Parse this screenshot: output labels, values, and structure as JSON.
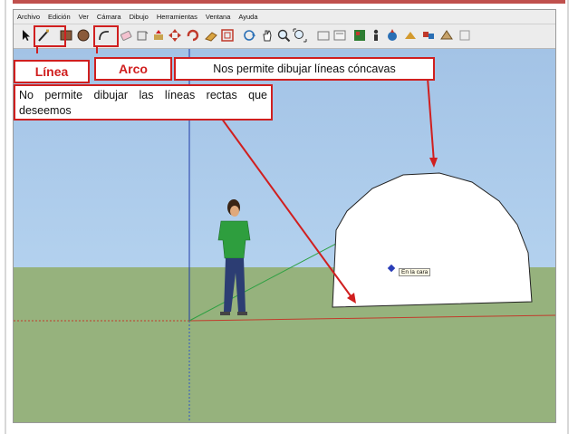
{
  "menu": {
    "items": [
      "Archivo",
      "Edición",
      "Ver",
      "Cámara",
      "Dibujo",
      "Herramientas",
      "Ventana",
      "Ayuda"
    ]
  },
  "toolbar": {
    "tools": [
      "select-tool",
      "line-tool",
      "rectangle-tool",
      "circle-tool",
      "arc-tool",
      "eraser-tool",
      "paint-tool",
      "push-pull-tool",
      "move-tool",
      "rotate-tool",
      "follow-me-tool",
      "offset-tool",
      "orbit-tool",
      "pan-tool",
      "zoom-tool",
      "zoom-extents-tool",
      "tape-tool",
      "text-tool",
      "walk-tool",
      "position-camera-tool",
      "look-around-tool",
      "section-tool",
      "components-tool",
      "3d-warehouse-tool"
    ]
  },
  "callouts": {
    "linea": "Línea",
    "arco": "Arco",
    "concavas": "Nos permite dibujar líneas cóncavas",
    "rectas": "No permite dibujar las líneas rectas que deseemos"
  },
  "viewport": {
    "tooltip": "En la cara"
  },
  "colors": {
    "accent_red": "#d01f1f",
    "sky": "#aeccea",
    "ground": "#96b27d",
    "shape_fill": "#ffffff"
  }
}
